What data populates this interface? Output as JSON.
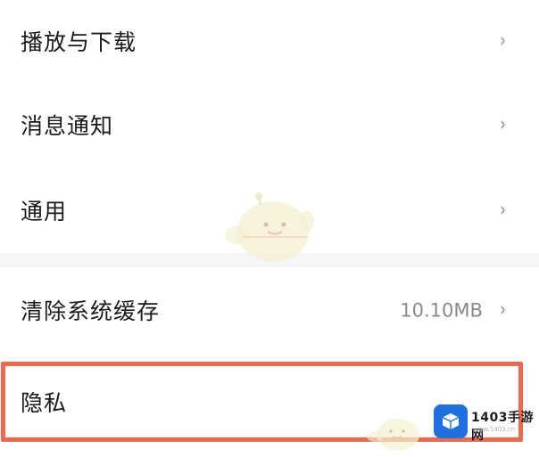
{
  "settings": {
    "items": [
      {
        "label": "播放与下载",
        "chevron": "›"
      },
      {
        "label": "消息通知",
        "chevron": "›"
      },
      {
        "label": "通用",
        "chevron": "›"
      },
      {
        "label": "清除系统缓存",
        "value": "10.10MB",
        "chevron": "›"
      },
      {
        "label": "隐私"
      }
    ]
  },
  "watermark": {
    "brand": "1403手游网",
    "url": "www.1403.cn"
  },
  "colors": {
    "highlight_border": "#ec6b4e",
    "divider": "#f5f6f8",
    "logo": "#1f6fe0"
  }
}
